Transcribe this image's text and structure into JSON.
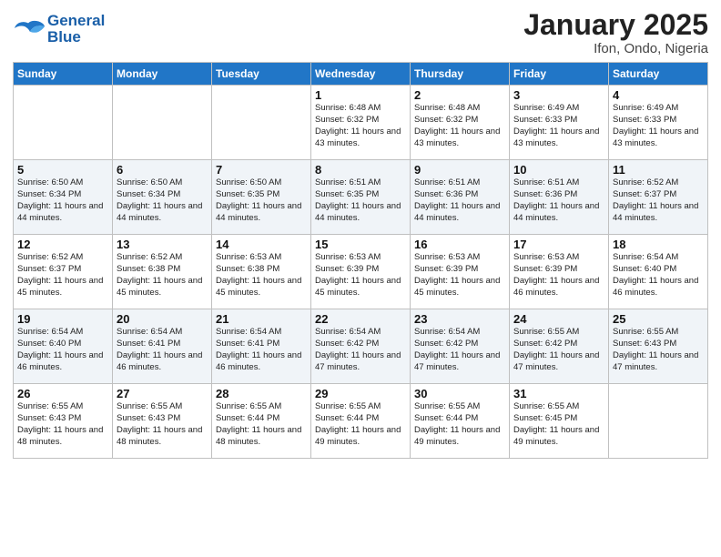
{
  "header": {
    "logo_line1": "General",
    "logo_line2": "Blue",
    "month": "January 2025",
    "location": "Ifon, Ondo, Nigeria"
  },
  "weekdays": [
    "Sunday",
    "Monday",
    "Tuesday",
    "Wednesday",
    "Thursday",
    "Friday",
    "Saturday"
  ],
  "weeks": [
    [
      {
        "day": "",
        "info": ""
      },
      {
        "day": "",
        "info": ""
      },
      {
        "day": "",
        "info": ""
      },
      {
        "day": "1",
        "info": "Sunrise: 6:48 AM\nSunset: 6:32 PM\nDaylight: 11 hours\nand 43 minutes."
      },
      {
        "day": "2",
        "info": "Sunrise: 6:48 AM\nSunset: 6:32 PM\nDaylight: 11 hours\nand 43 minutes."
      },
      {
        "day": "3",
        "info": "Sunrise: 6:49 AM\nSunset: 6:33 PM\nDaylight: 11 hours\nand 43 minutes."
      },
      {
        "day": "4",
        "info": "Sunrise: 6:49 AM\nSunset: 6:33 PM\nDaylight: 11 hours\nand 43 minutes."
      }
    ],
    [
      {
        "day": "5",
        "info": "Sunrise: 6:50 AM\nSunset: 6:34 PM\nDaylight: 11 hours\nand 44 minutes."
      },
      {
        "day": "6",
        "info": "Sunrise: 6:50 AM\nSunset: 6:34 PM\nDaylight: 11 hours\nand 44 minutes."
      },
      {
        "day": "7",
        "info": "Sunrise: 6:50 AM\nSunset: 6:35 PM\nDaylight: 11 hours\nand 44 minutes."
      },
      {
        "day": "8",
        "info": "Sunrise: 6:51 AM\nSunset: 6:35 PM\nDaylight: 11 hours\nand 44 minutes."
      },
      {
        "day": "9",
        "info": "Sunrise: 6:51 AM\nSunset: 6:36 PM\nDaylight: 11 hours\nand 44 minutes."
      },
      {
        "day": "10",
        "info": "Sunrise: 6:51 AM\nSunset: 6:36 PM\nDaylight: 11 hours\nand 44 minutes."
      },
      {
        "day": "11",
        "info": "Sunrise: 6:52 AM\nSunset: 6:37 PM\nDaylight: 11 hours\nand 44 minutes."
      }
    ],
    [
      {
        "day": "12",
        "info": "Sunrise: 6:52 AM\nSunset: 6:37 PM\nDaylight: 11 hours\nand 45 minutes."
      },
      {
        "day": "13",
        "info": "Sunrise: 6:52 AM\nSunset: 6:38 PM\nDaylight: 11 hours\nand 45 minutes."
      },
      {
        "day": "14",
        "info": "Sunrise: 6:53 AM\nSunset: 6:38 PM\nDaylight: 11 hours\nand 45 minutes."
      },
      {
        "day": "15",
        "info": "Sunrise: 6:53 AM\nSunset: 6:39 PM\nDaylight: 11 hours\nand 45 minutes."
      },
      {
        "day": "16",
        "info": "Sunrise: 6:53 AM\nSunset: 6:39 PM\nDaylight: 11 hours\nand 45 minutes."
      },
      {
        "day": "17",
        "info": "Sunrise: 6:53 AM\nSunset: 6:39 PM\nDaylight: 11 hours\nand 46 minutes."
      },
      {
        "day": "18",
        "info": "Sunrise: 6:54 AM\nSunset: 6:40 PM\nDaylight: 11 hours\nand 46 minutes."
      }
    ],
    [
      {
        "day": "19",
        "info": "Sunrise: 6:54 AM\nSunset: 6:40 PM\nDaylight: 11 hours\nand 46 minutes."
      },
      {
        "day": "20",
        "info": "Sunrise: 6:54 AM\nSunset: 6:41 PM\nDaylight: 11 hours\nand 46 minutes."
      },
      {
        "day": "21",
        "info": "Sunrise: 6:54 AM\nSunset: 6:41 PM\nDaylight: 11 hours\nand 46 minutes."
      },
      {
        "day": "22",
        "info": "Sunrise: 6:54 AM\nSunset: 6:42 PM\nDaylight: 11 hours\nand 47 minutes."
      },
      {
        "day": "23",
        "info": "Sunrise: 6:54 AM\nSunset: 6:42 PM\nDaylight: 11 hours\nand 47 minutes."
      },
      {
        "day": "24",
        "info": "Sunrise: 6:55 AM\nSunset: 6:42 PM\nDaylight: 11 hours\nand 47 minutes."
      },
      {
        "day": "25",
        "info": "Sunrise: 6:55 AM\nSunset: 6:43 PM\nDaylight: 11 hours\nand 47 minutes."
      }
    ],
    [
      {
        "day": "26",
        "info": "Sunrise: 6:55 AM\nSunset: 6:43 PM\nDaylight: 11 hours\nand 48 minutes."
      },
      {
        "day": "27",
        "info": "Sunrise: 6:55 AM\nSunset: 6:43 PM\nDaylight: 11 hours\nand 48 minutes."
      },
      {
        "day": "28",
        "info": "Sunrise: 6:55 AM\nSunset: 6:44 PM\nDaylight: 11 hours\nand 48 minutes."
      },
      {
        "day": "29",
        "info": "Sunrise: 6:55 AM\nSunset: 6:44 PM\nDaylight: 11 hours\nand 49 minutes."
      },
      {
        "day": "30",
        "info": "Sunrise: 6:55 AM\nSunset: 6:44 PM\nDaylight: 11 hours\nand 49 minutes."
      },
      {
        "day": "31",
        "info": "Sunrise: 6:55 AM\nSunset: 6:45 PM\nDaylight: 11 hours\nand 49 minutes."
      },
      {
        "day": "",
        "info": ""
      }
    ]
  ]
}
